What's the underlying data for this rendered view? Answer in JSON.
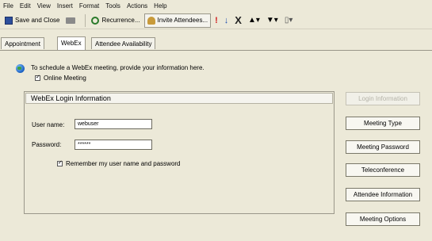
{
  "menubar": [
    "File",
    "Edit",
    "View",
    "Insert",
    "Format",
    "Tools",
    "Actions",
    "Help"
  ],
  "toolbar": {
    "save_close": "Save and Close",
    "recurrence": "Recurrence...",
    "invite": "Invite Attendees...",
    "importance_high": "!",
    "importance_low": "↓",
    "delete": "X"
  },
  "tabs": [
    "Appointment",
    "WebEx",
    "Attendee Availability"
  ],
  "intro_text": "To schedule a WebEx meeting, provide your information here.",
  "online_meeting_label": "Online Meeting",
  "panel": {
    "header": "WebEx Login Information",
    "username_label": "User name:",
    "username_value": "webuser",
    "password_label": "Password:",
    "password_value": "******",
    "remember_label": "Remember my user name and password"
  },
  "right_buttons": {
    "login_info": "Login Information",
    "meeting_type": "Meeting Type",
    "meeting_password": "Meeting Password",
    "teleconference": "Teleconference",
    "attendee_information": "Attendee Information",
    "meeting_options": "Meeting Options"
  }
}
